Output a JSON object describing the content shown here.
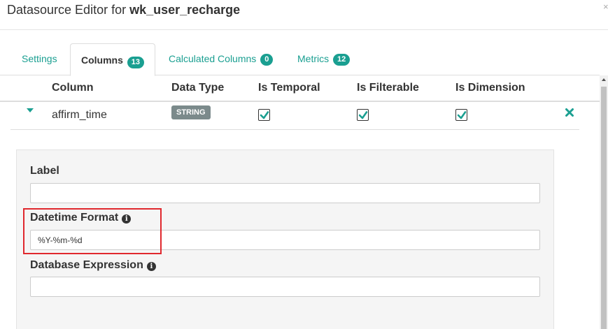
{
  "header": {
    "title_prefix": "Datasource Editor for ",
    "title_name": "wk_user_recharge",
    "close_glyph": "×"
  },
  "tabs": [
    {
      "label": "Settings",
      "count": null,
      "active": false
    },
    {
      "label": "Columns",
      "count": "13",
      "active": true
    },
    {
      "label": "Calculated Columns",
      "count": "0",
      "active": false
    },
    {
      "label": "Metrics",
      "count": "12",
      "active": false
    }
  ],
  "table": {
    "headers": [
      "Column",
      "Data Type",
      "Is Temporal",
      "Is Filterable",
      "Is Dimension"
    ],
    "rows": [
      {
        "name": "affirm_time",
        "data_type": "STRING",
        "is_temporal": true,
        "is_filterable": true,
        "is_dimension": true,
        "delete_icon": "close-icon"
      }
    ]
  },
  "details": {
    "label_field": {
      "label": "Label",
      "value": ""
    },
    "datetime_field": {
      "label": "Datetime Format",
      "value": "%Y-%m-%d",
      "icon": "info-icon"
    },
    "expression_field": {
      "label": "Database Expression",
      "value": "",
      "icon": "info-icon"
    }
  },
  "colors": {
    "accent": "#1a9f91",
    "highlight": "#e0282e",
    "type_label": "#7b8a8b"
  }
}
